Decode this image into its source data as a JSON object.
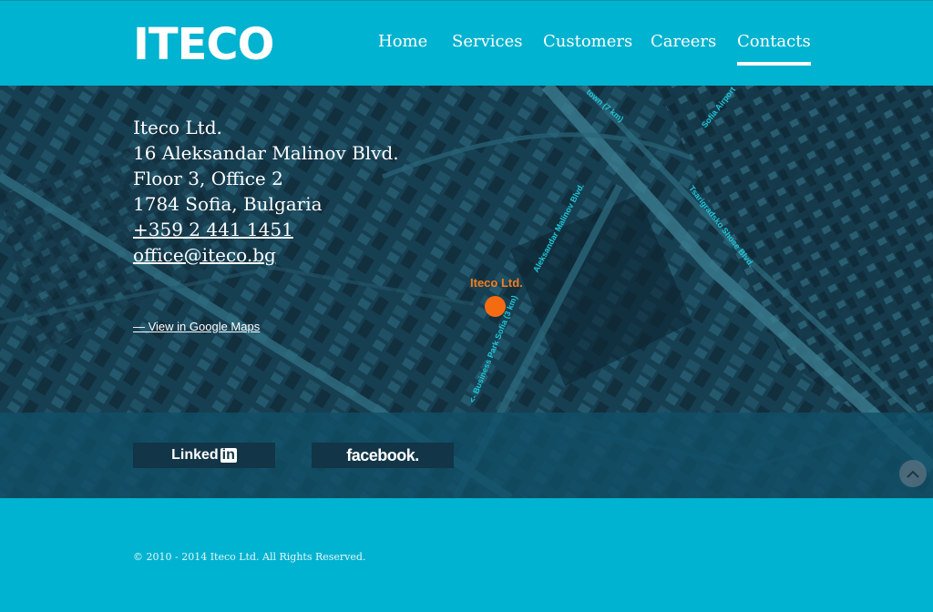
{
  "header": {
    "logo_text": "ITECO",
    "nav": [
      {
        "label": "Home"
      },
      {
        "label": "Services"
      },
      {
        "label": "Customers"
      },
      {
        "label": "Careers"
      },
      {
        "label": "Contacts",
        "active": true
      }
    ]
  },
  "contact": {
    "company": "Iteco Ltd.",
    "street": "16 Aleksandar Malinov Blvd.",
    "floor": "Floor 3, Office 2",
    "city": "1784 Sofia, Bulgaria",
    "phone": "+359 2 441 1451",
    "email": "office@iteco.bg",
    "google_maps_link": "— View in Google Maps"
  },
  "map": {
    "marker_label": "Iteco Ltd.",
    "road_labels": [
      "Aleksandar Malinov Blvd.",
      "<- Business Park Sofia (3 km)",
      "Tsarigradsko Shose Blvd.",
      "Sofia Airport",
      "town (7 km)"
    ]
  },
  "social": {
    "linkedin_label": "Linked",
    "linkedin_in": "in",
    "facebook_label": "facebook."
  },
  "footer": {
    "copyright": "© 2010 - 2014 Iteco Ltd. All Rights Reserved."
  },
  "colors": {
    "brand": "#00b3d0",
    "map_base": "#153d50",
    "marker": "#f56b12",
    "road_label": "#1ec7d8"
  }
}
